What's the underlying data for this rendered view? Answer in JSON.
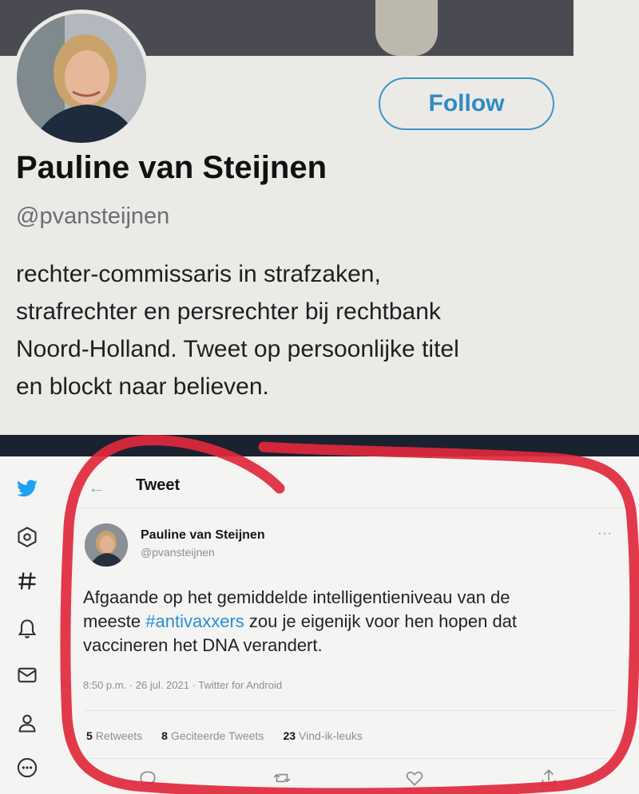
{
  "profile": {
    "follow_label": "Follow",
    "name": "Pauline van Steijnen",
    "handle": "@pvansteijnen",
    "bio_lines": [
      "rechter-commissaris in strafzaken,",
      "strafrechter en persrechter bij rechtbank",
      "Noord-Holland. Tweet op persoonlijke titel",
      "en blockt naar believen."
    ]
  },
  "sidebar": {
    "icons": [
      "twitter-bird-icon",
      "explore-icon",
      "hashtag-icon",
      "notifications-bell-icon",
      "messages-envelope-icon",
      "profile-person-icon",
      "more-circle-icon"
    ]
  },
  "tweet_view": {
    "header": "Tweet",
    "author_name": "Pauline van Steijnen",
    "author_handle": "@pvansteijnen",
    "more_label": "···",
    "text_line1": "Afgaande op het gemiddelde intelligentieniveau van de",
    "text_line2_pre": "meeste ",
    "hashtag": "#antivaxxers",
    "text_line2_post": " zou je eigenijk voor hen hopen dat",
    "text_line3": "vaccineren het DNA verandert.",
    "meta": "8:50 p.m. · 26 jul. 2021 · Twitter for Android",
    "stats": {
      "retweets_count": "5",
      "retweets_label": "Retweets",
      "quotes_count": "8",
      "quotes_label": "Geciteerde Tweets",
      "likes_count": "23",
      "likes_label": "Vind-ik-leuks"
    }
  },
  "colors": {
    "follow_border": "#3f96c7",
    "hashtag": "#2a8fd4",
    "twitter_blue": "#1da1f2",
    "annotation_red": "#e0283c"
  }
}
